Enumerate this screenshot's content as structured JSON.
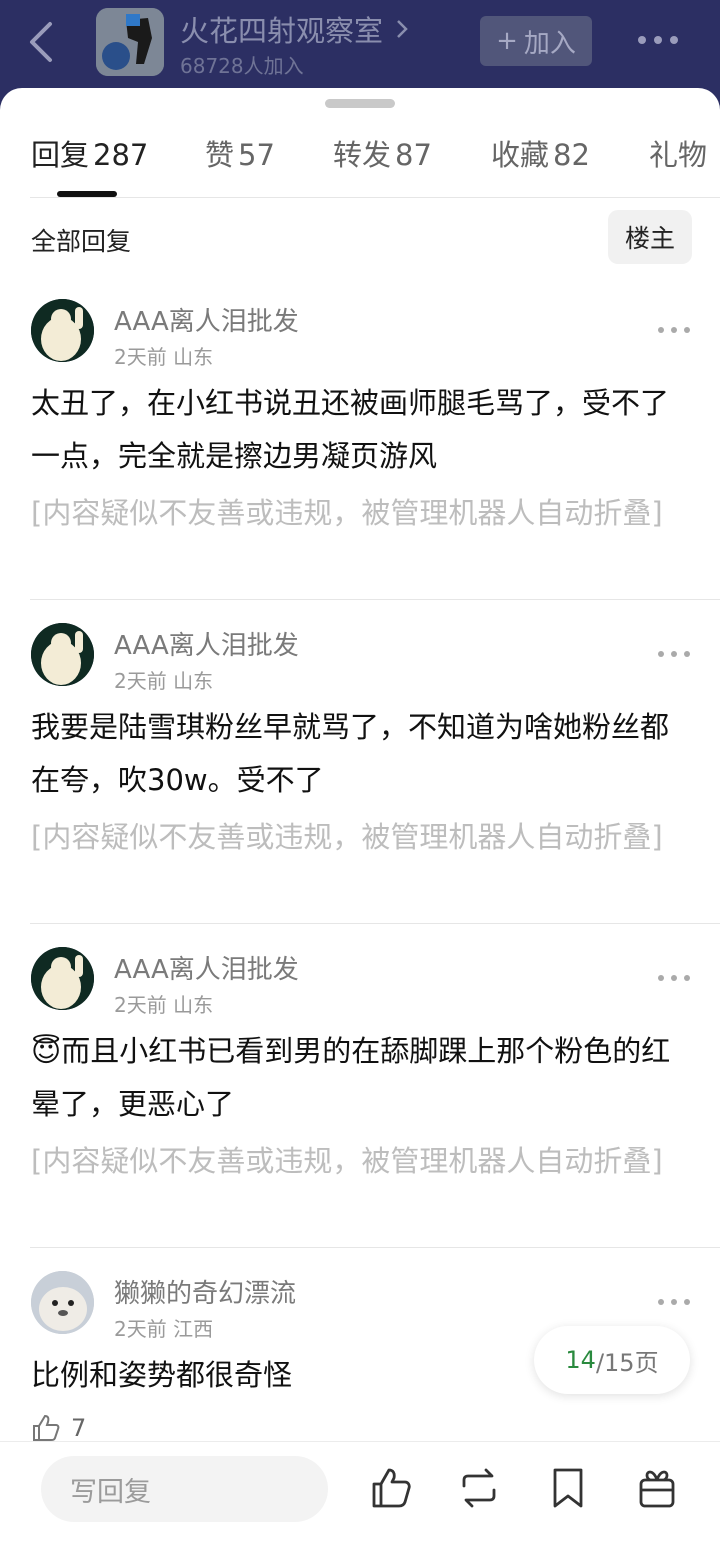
{
  "header": {
    "group_title": "火花四射观察室",
    "member_count": "68728人加入",
    "join_label": "加入"
  },
  "tabs": [
    {
      "label": "回复",
      "count": "287"
    },
    {
      "label": "赞",
      "count": "57"
    },
    {
      "label": "转发",
      "count": "87"
    },
    {
      "label": "收藏",
      "count": "82"
    },
    {
      "label": "礼物",
      "count": ""
    }
  ],
  "filter": {
    "all_replies": "全部回复",
    "op_only": "楼主"
  },
  "comments": [
    {
      "username": "AAA离人泪批发",
      "time": "2天前",
      "location": "山东",
      "text": "太丑了，在小红书说丑还被画师腿毛骂了，受不了一点，完全就是擦边男凝页游风",
      "folded_notice": "[内容疑似不友善或违规，被管理机器人自动折叠]"
    },
    {
      "username": "AAA离人泪批发",
      "time": "2天前",
      "location": "山东",
      "text": "我要是陆雪琪粉丝早就骂了，不知道为啥她粉丝都在夸，吹30w。受不了",
      "folded_notice": "[内容疑似不友善或违规，被管理机器人自动折叠]"
    },
    {
      "username": "AAA离人泪批发",
      "time": "2天前",
      "location": "山东",
      "text": "😇而且小红书已看到男的在舔脚踝上那个粉色的红晕了，更恶心了",
      "folded_notice": "[内容疑似不友善或违规，被管理机器人自动折叠]"
    },
    {
      "username": "獭獭的奇幻漂流",
      "time": "2天前",
      "location": "江西",
      "text": "比例和姿势都很奇怪",
      "like_count": "7"
    }
  ],
  "pagination": {
    "current": "14",
    "total_label": "/15页"
  },
  "bottom_bar": {
    "reply_placeholder": "写回复"
  },
  "colors": {
    "header_bg": "#2c2f63",
    "page_current": "#2a8a3e",
    "folded_text": "#bdbdbd"
  },
  "icons": [
    "back-icon",
    "chevron-right-icon",
    "plus-icon",
    "more-icon",
    "thumb-up-icon",
    "repost-icon",
    "bookmark-icon",
    "gift-icon"
  ]
}
